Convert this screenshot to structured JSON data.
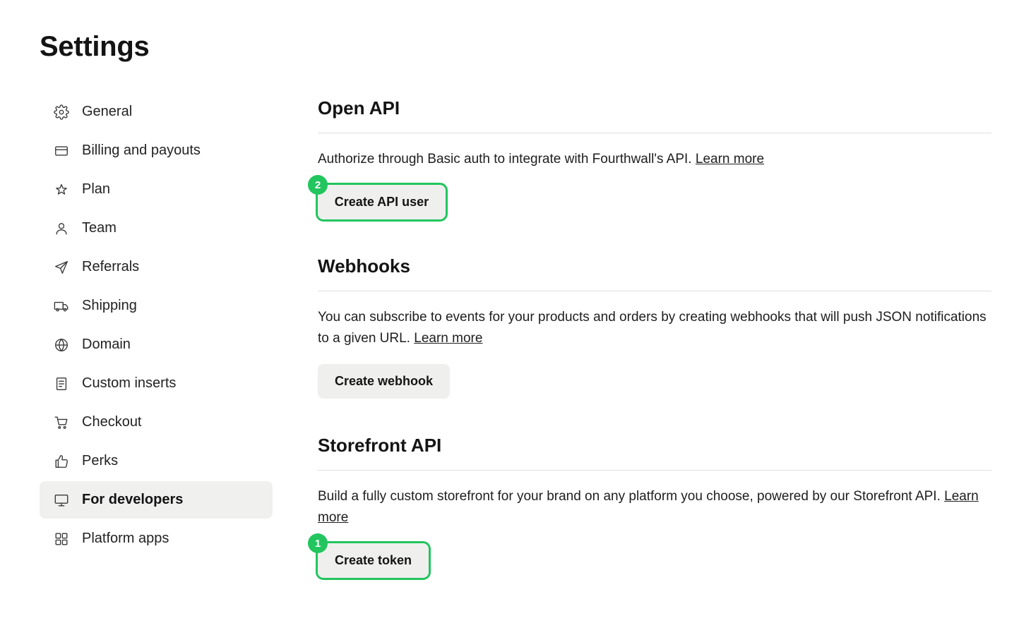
{
  "page": {
    "title": "Settings"
  },
  "sidebar": {
    "items": [
      {
        "label": "General",
        "icon": "gear-icon"
      },
      {
        "label": "Billing and payouts",
        "icon": "credit-card-icon"
      },
      {
        "label": "Plan",
        "icon": "star-icon"
      },
      {
        "label": "Team",
        "icon": "user-icon"
      },
      {
        "label": "Referrals",
        "icon": "send-icon"
      },
      {
        "label": "Shipping",
        "icon": "truck-icon"
      },
      {
        "label": "Domain",
        "icon": "globe-icon"
      },
      {
        "label": "Custom inserts",
        "icon": "document-icon"
      },
      {
        "label": "Checkout",
        "icon": "cart-icon"
      },
      {
        "label": "Perks",
        "icon": "thumbs-up-icon"
      },
      {
        "label": "For developers",
        "icon": "monitor-icon",
        "active": true
      },
      {
        "label": "Platform apps",
        "icon": "grid-icon"
      }
    ]
  },
  "sections": {
    "open_api": {
      "title": "Open API",
      "description": "Authorize through Basic auth to integrate with Fourthwall's API.",
      "link": "Learn more",
      "button": "Create API user",
      "badge": "2"
    },
    "webhooks": {
      "title": "Webhooks",
      "description": "You can subscribe to events for your products and orders by creating webhooks that will push JSON notifications to a given URL.",
      "link": "Learn more",
      "button": "Create webhook"
    },
    "storefront_api": {
      "title": "Storefront API",
      "description": "Build a fully custom storefront for your brand on any platform you choose, powered by our Storefront API.",
      "link": "Learn more",
      "button": "Create token",
      "badge": "1"
    }
  },
  "colors": {
    "highlight": "#22c55e",
    "active_bg": "#f0f0ef",
    "button_bg": "#efefee"
  }
}
